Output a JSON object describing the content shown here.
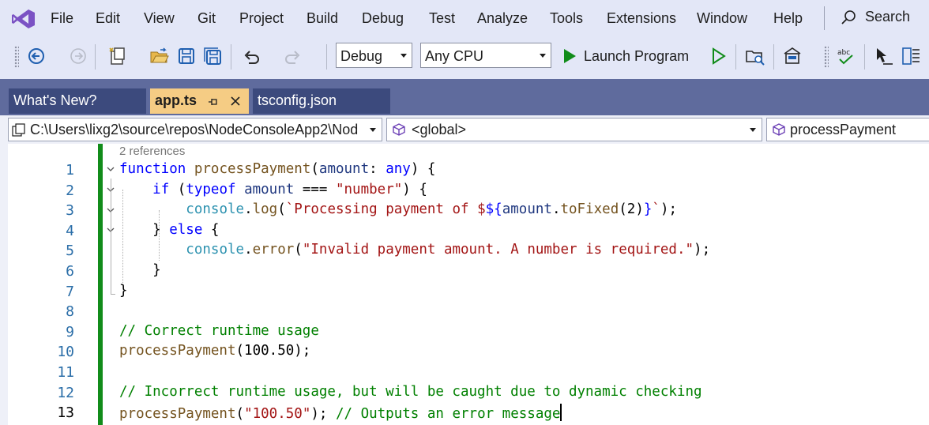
{
  "menu": [
    "File",
    "Edit",
    "View",
    "Git",
    "Project",
    "Build",
    "Debug",
    "Test",
    "Analyze",
    "Tools",
    "Extensions",
    "Window",
    "Help"
  ],
  "search_label": "Search",
  "toolbar": {
    "configuration": "Debug",
    "platform": "Any CPU",
    "launch_label": "Launch Program"
  },
  "tabs": [
    {
      "label": "What's New?",
      "active": false
    },
    {
      "label": "app.ts",
      "active": true
    },
    {
      "label": "tsconfig.json",
      "active": false
    }
  ],
  "navbar": {
    "project_path": "C:\\Users\\lixg2\\source\\repos\\NodeConsoleApp2\\Nod",
    "scope": "<global>",
    "member": "processPayment"
  },
  "editor": {
    "codelens": "2 references",
    "line_numbers": [
      "1",
      "2",
      "3",
      "4",
      "5",
      "6",
      "7",
      "8",
      "9",
      "10",
      "11",
      "12",
      "13"
    ],
    "current_line": "13",
    "lines": [
      [
        [
          "kw",
          "function"
        ],
        [
          "pl",
          " "
        ],
        [
          "fn",
          "processPayment"
        ],
        [
          "pl",
          "("
        ],
        [
          "id",
          "amount"
        ],
        [
          "pl",
          ": "
        ],
        [
          "kw",
          "any"
        ],
        [
          "pl",
          ") {"
        ]
      ],
      [
        [
          "pl",
          "    "
        ],
        [
          "kw",
          "if"
        ],
        [
          "pl",
          " ("
        ],
        [
          "kw",
          "typeof"
        ],
        [
          "pl",
          " "
        ],
        [
          "id",
          "amount"
        ],
        [
          "pl",
          " === "
        ],
        [
          "str",
          "\"number\""
        ],
        [
          "pl",
          ") {"
        ]
      ],
      [
        [
          "pl",
          "        "
        ],
        [
          "cls",
          "console"
        ],
        [
          "pl",
          "."
        ],
        [
          "fn",
          "log"
        ],
        [
          "pl",
          "("
        ],
        [
          "tmpl",
          "`Processing payment of $"
        ],
        [
          "kw",
          "${"
        ],
        [
          "id",
          "amount"
        ],
        [
          "pl",
          "."
        ],
        [
          "fn",
          "toFixed"
        ],
        [
          "pl",
          "(2)"
        ],
        [
          "kw",
          "}"
        ],
        [
          "tmpl",
          "`"
        ],
        [
          "pl",
          ");"
        ]
      ],
      [
        [
          "pl",
          "    } "
        ],
        [
          "kw",
          "else"
        ],
        [
          "pl",
          " {"
        ]
      ],
      [
        [
          "pl",
          "        "
        ],
        [
          "cls",
          "console"
        ],
        [
          "pl",
          "."
        ],
        [
          "fn",
          "error"
        ],
        [
          "pl",
          "("
        ],
        [
          "str",
          "\"Invalid payment amount. A number is required.\""
        ],
        [
          "pl",
          ");"
        ]
      ],
      [
        [
          "pl",
          "    }"
        ]
      ],
      [
        [
          "pl",
          "}"
        ]
      ],
      [],
      [
        [
          "cm",
          "// Correct runtime usage"
        ]
      ],
      [
        [
          "fn",
          "processPayment"
        ],
        [
          "pl",
          "(100.50);"
        ]
      ],
      [],
      [
        [
          "cm",
          "// Incorrect runtime usage, but will be caught due to dynamic checking"
        ]
      ],
      [
        [
          "fn",
          "processPayment"
        ],
        [
          "pl",
          "("
        ],
        [
          "str",
          "\"100.50\""
        ],
        [
          "pl",
          "); "
        ],
        [
          "cm",
          "// Outputs an error message"
        ]
      ]
    ]
  },
  "colors": {
    "accent_tab": "#f5cc84",
    "tabstrip": "#5f6b9d",
    "change_bar": "#118c1a",
    "line_number": "#2b6ea8"
  }
}
